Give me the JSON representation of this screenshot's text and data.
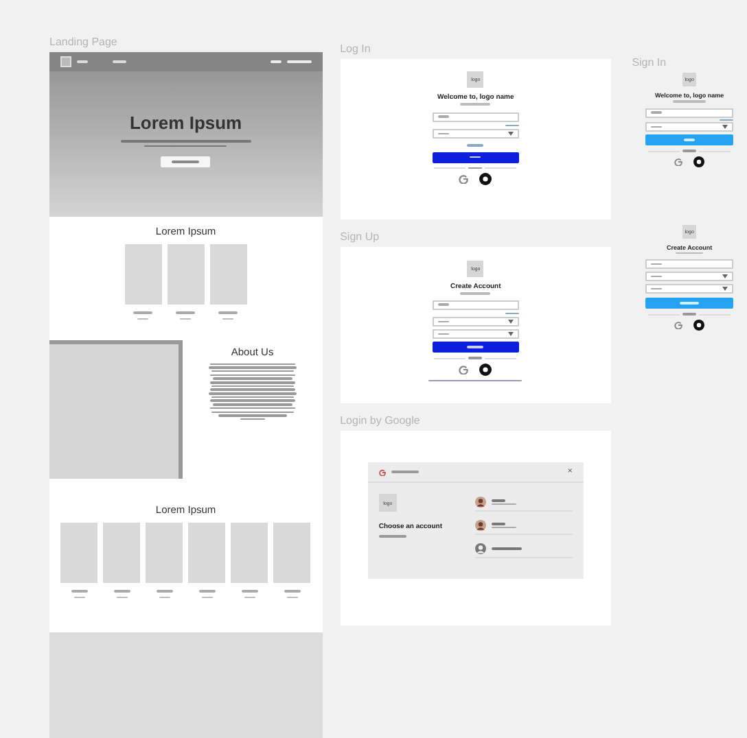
{
  "landing": {
    "label": "Landing Page",
    "hero_title": "Lorem Ipsum",
    "section_title": "Lorem Ipsum",
    "about_title": "About Us",
    "gallery_title": "Lorem Ipsum"
  },
  "login": {
    "label": "Log In",
    "logo": "logo",
    "title": "Welcome to, logo name"
  },
  "signup": {
    "label": "Sign Up",
    "logo": "logo",
    "title": "Create Account"
  },
  "google": {
    "label": "Login by Google",
    "logo": "logo",
    "title": "Choose an account",
    "close": "×"
  },
  "mobile_signin": {
    "label": "Sign In",
    "logo": "logo",
    "title": "Welcome to, logo name"
  },
  "mobile_signup": {
    "logo": "logo",
    "title": "Create Account"
  }
}
